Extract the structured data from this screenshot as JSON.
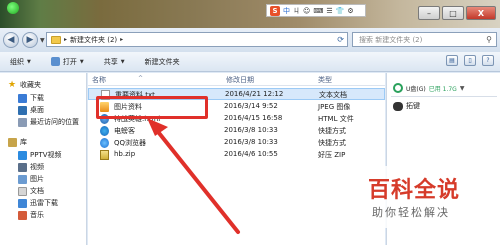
{
  "ime": {
    "brand": "S",
    "items": [
      "中",
      "ㄐ",
      "☺",
      "⌨",
      "☰",
      "👕",
      "⚙"
    ]
  },
  "window": {
    "minimize": "–",
    "maximize": "□",
    "close": "X"
  },
  "nav": {
    "back": "◀",
    "forward": "▶"
  },
  "address": {
    "path": "新建文件夹 (2)"
  },
  "search": {
    "placeholder": "搜索 新建文件夹 (2)"
  },
  "toolbar": {
    "organize": "组织",
    "open": "打开",
    "share": "共享",
    "new_folder": "新建文件夹"
  },
  "sidebar": {
    "favorites": "收藏夹",
    "favorites_items": [
      "下载",
      "桌面",
      "最近访问的位置"
    ],
    "libraries": "库",
    "library_items": [
      "PPTV视频",
      "视频",
      "图片",
      "文档",
      "迅雷下载",
      "音乐"
    ]
  },
  "columns": {
    "name": "名称",
    "date": "修改日期",
    "type": "类型"
  },
  "files": [
    {
      "name": "重要资料.txt",
      "date": "2016/4/21 12:12",
      "type": "文本文档",
      "icon": "txt-icon",
      "selected": true
    },
    {
      "name": "图片资料",
      "date": "2016/3/14 9:52",
      "type": "JPEG 图像",
      "icon": "jpg-icon",
      "selected": false
    },
    {
      "name": "特战英雄.html",
      "date": "2016/4/15 16:58",
      "type": "HTML 文件",
      "icon": "html-icon",
      "selected": false
    },
    {
      "name": "电螃客",
      "date": "2016/3/8 10:33",
      "type": "快捷方式",
      "icon": "mail-icon",
      "selected": false
    },
    {
      "name": "QQ浏览器",
      "date": "2016/3/8 10:33",
      "type": "快捷方式",
      "icon": "qq-icon",
      "selected": false
    },
    {
      "name": "hb.zip",
      "date": "2016/4/6 10:55",
      "type": "好压 ZIP",
      "icon": "zip-icon",
      "selected": false
    }
  ],
  "udisk": {
    "label": "U盘(G)",
    "status": "已用 1.7G",
    "extension": "拓键"
  },
  "watermark": {
    "main": "百科全说",
    "sub": "助你轻松解决"
  }
}
